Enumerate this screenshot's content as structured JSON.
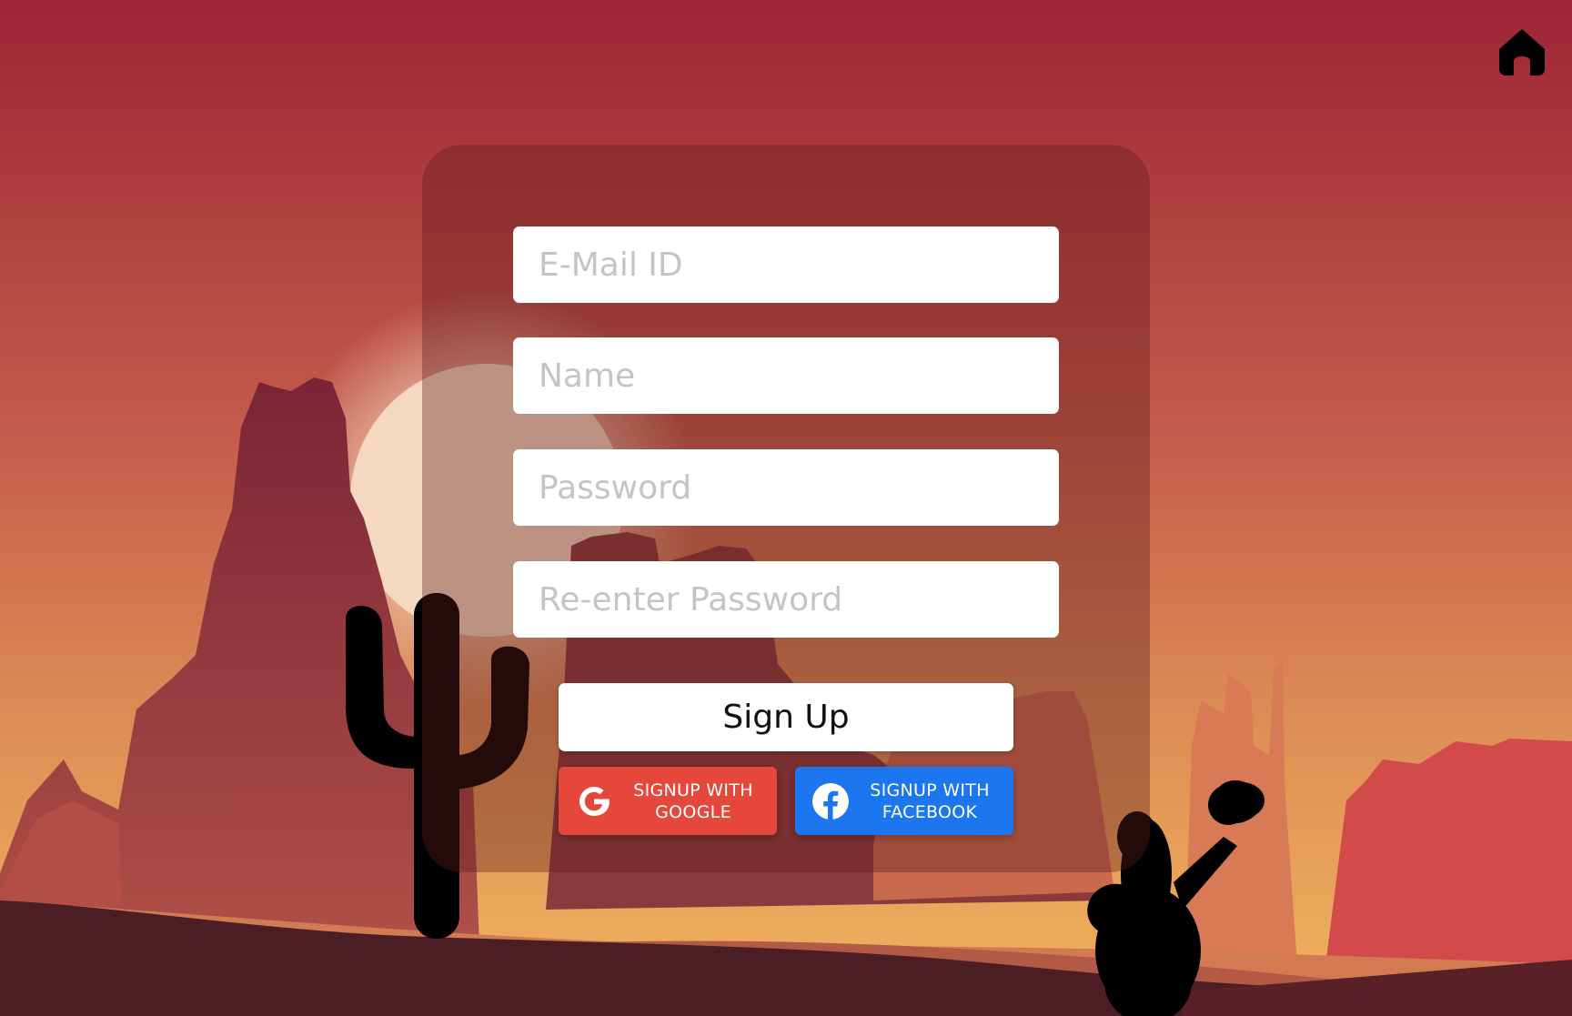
{
  "colors": {
    "sky_top": "#9e2536",
    "sky_bottom": "#e6a45a",
    "sun": "#f4d9c0",
    "google": "#e5473a",
    "facebook": "#1b76ef"
  },
  "header": {
    "home_icon": "home-icon"
  },
  "form": {
    "email_placeholder": "E-Mail ID",
    "name_placeholder": "Name",
    "password_placeholder": "Password",
    "reenter_password_placeholder": "Re-enter Password",
    "signup_label": "Sign Up"
  },
  "social": {
    "google": {
      "line1": "SIGNUP WITH",
      "line2": "GOOGLE",
      "icon": "google-icon"
    },
    "facebook": {
      "line1": "SIGNUP WITH",
      "line2": "FACEBOOK",
      "icon": "facebook-icon"
    }
  }
}
